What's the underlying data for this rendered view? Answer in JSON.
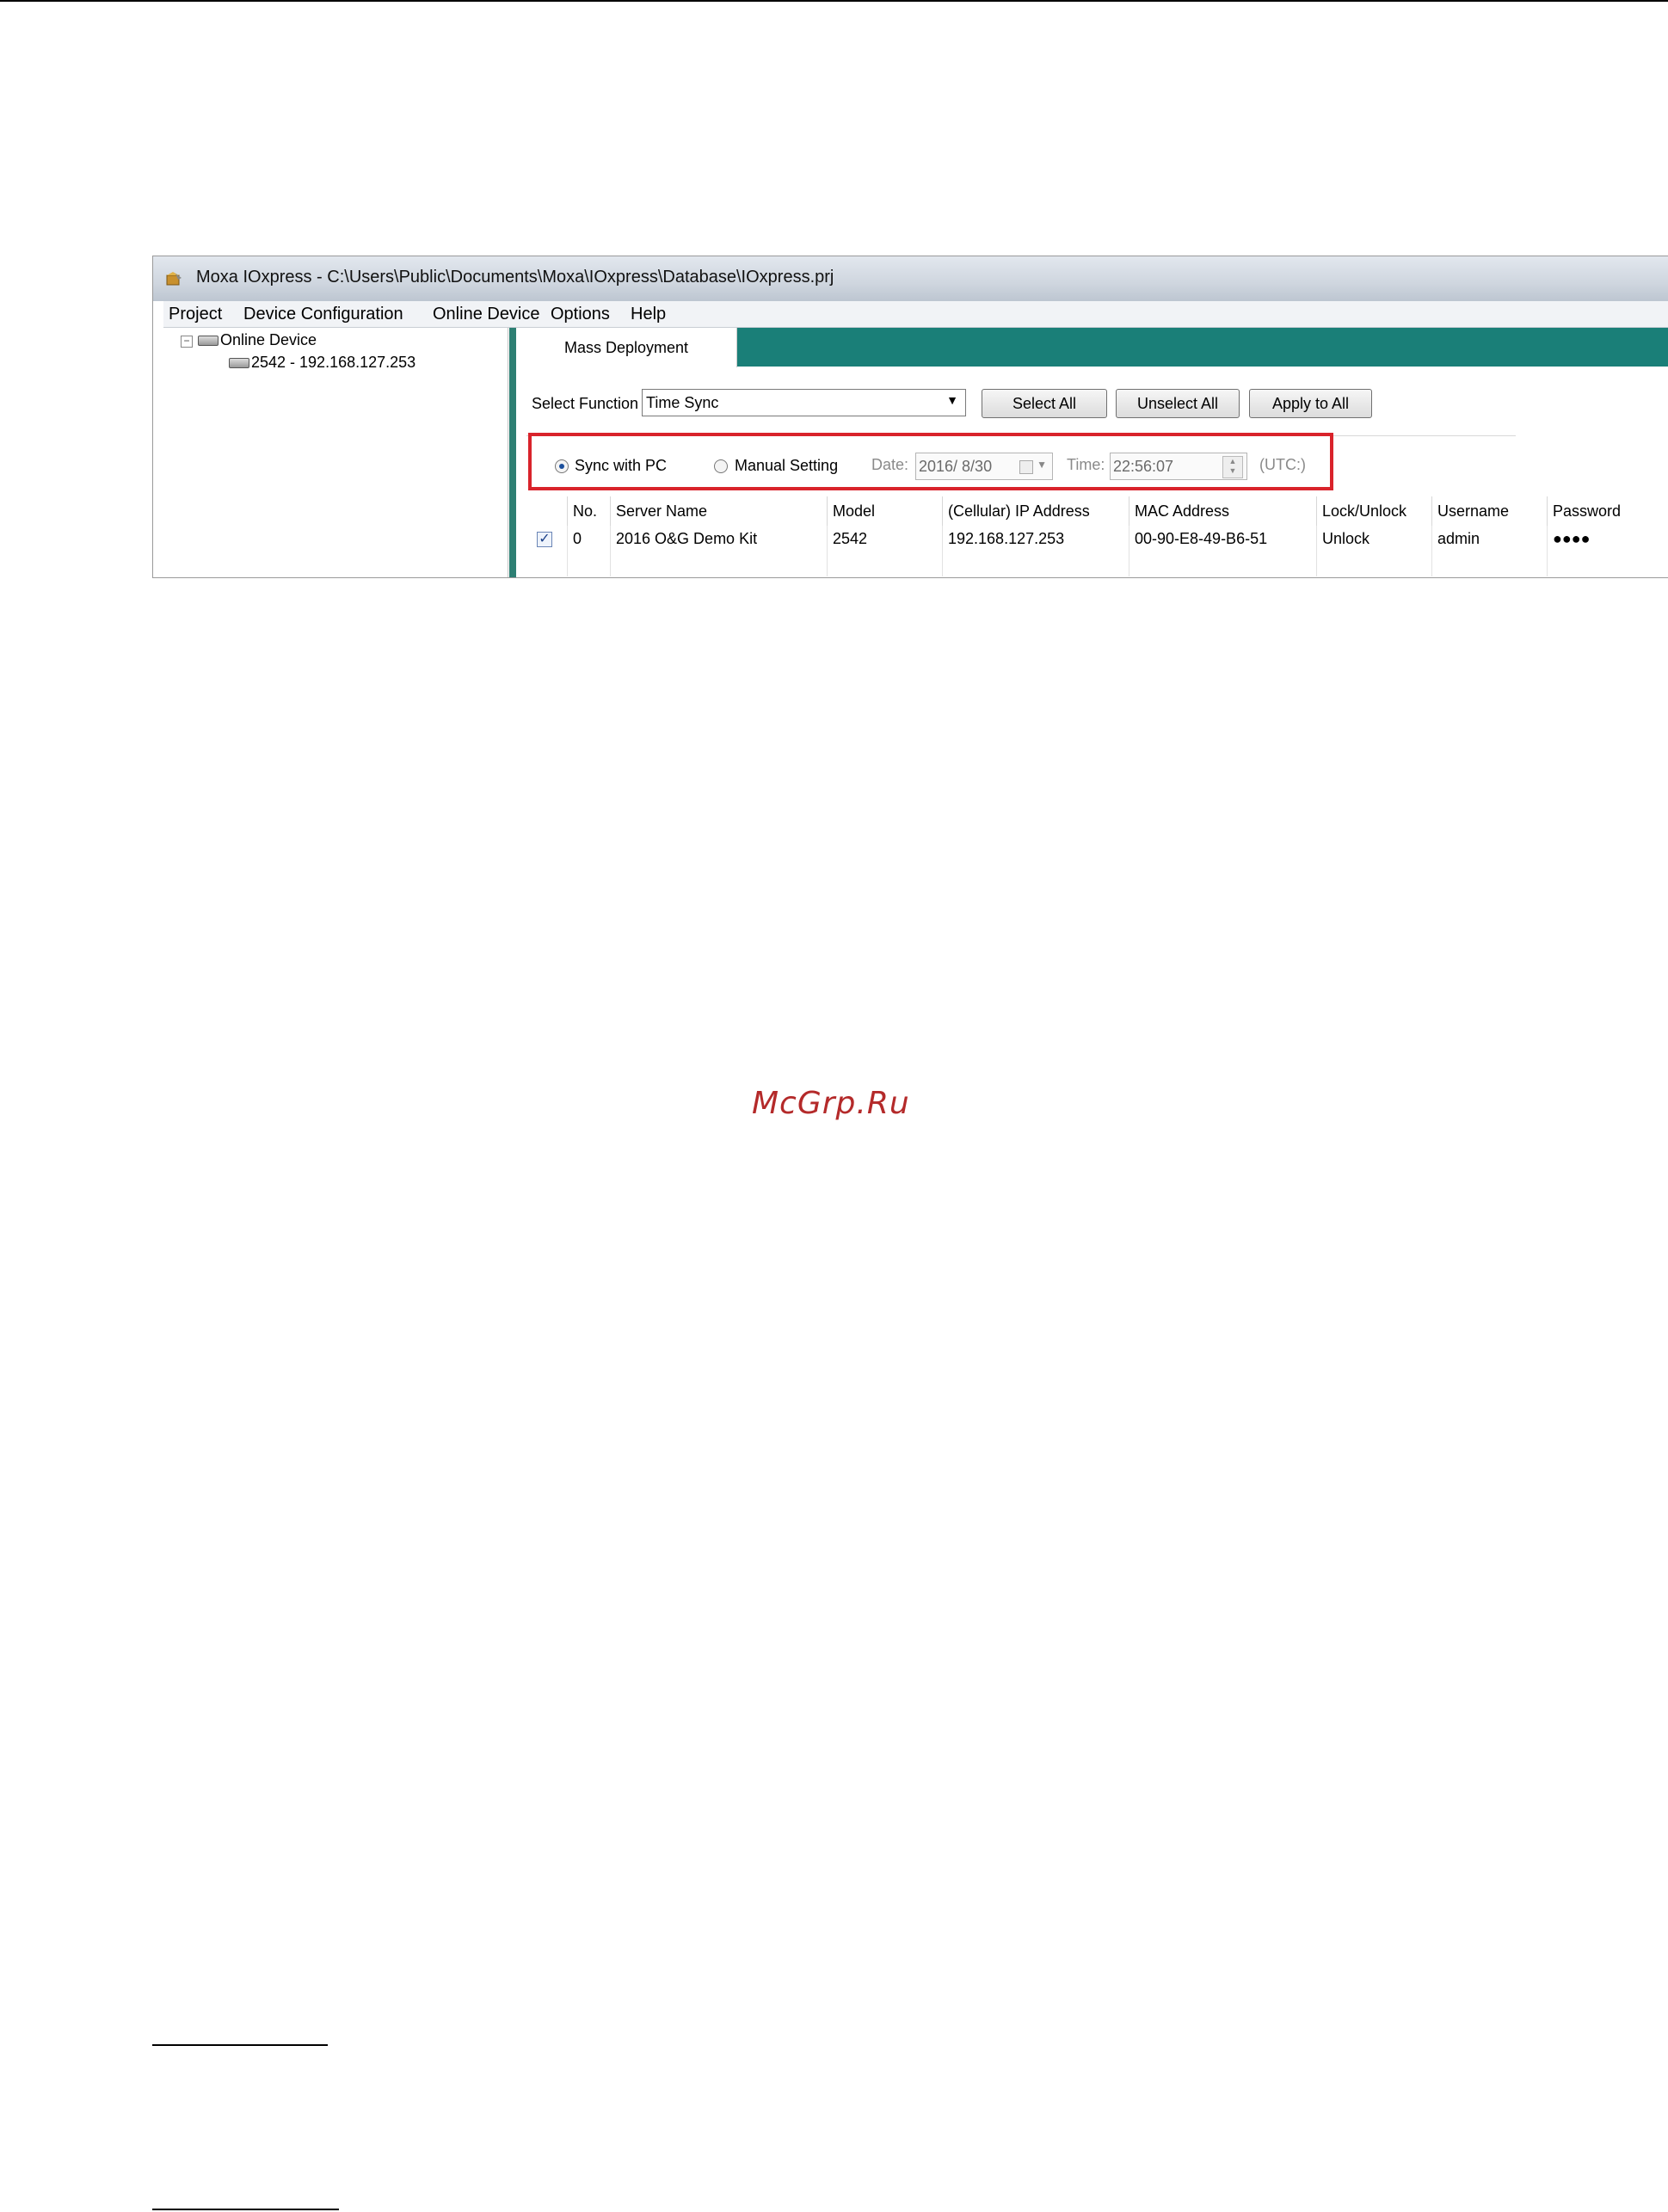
{
  "window": {
    "title": "Moxa IOxpress - C:\\Users\\Public\\Documents\\Moxa\\IOxpress\\Database\\IOxpress.prj"
  },
  "menu": [
    "Project",
    "Device Configuration",
    "Online Device",
    "Options",
    "Help"
  ],
  "tree": {
    "root": "Online Device",
    "child": "2542 - 192.168.127.253"
  },
  "tab": {
    "label": "Mass Deployment"
  },
  "toolbar": {
    "select_function_label": "Select Function",
    "select_function_value": "Time Sync",
    "select_all": "Select All",
    "unselect_all": "Unselect All",
    "apply_to_all": "Apply to All"
  },
  "sync": {
    "sync_with_pc": "Sync with PC",
    "manual_setting": "Manual Setting",
    "selected": "Sync with PC",
    "date_label": "Date:",
    "date_value": "2016/ 8/30",
    "time_label": "Time:",
    "time_value": "22:56:07",
    "utc_label": "(UTC:)"
  },
  "table": {
    "columns": [
      "No.",
      "Server Name",
      "Model",
      "(Cellular) IP Address",
      "MAC Address",
      "Lock/Unlock",
      "Username",
      "Password"
    ],
    "rows": [
      {
        "checked": true,
        "cells": [
          "0",
          "2016 O&G Demo Kit",
          "2542",
          "192.168.127.253",
          "00-90-E8-49-B6-51",
          "Unlock",
          "admin",
          "●●●●"
        ]
      }
    ]
  },
  "watermark": "McGrp.Ru"
}
